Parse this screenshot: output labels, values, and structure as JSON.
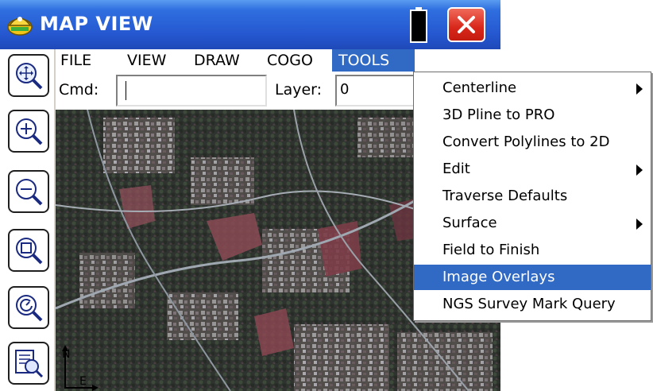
{
  "window": {
    "title": "MAP VIEW",
    "icons": {
      "app": "surveyor-hardhat-icon",
      "battery": "battery-icon",
      "close": "close-icon"
    },
    "colors": {
      "titlebar": "#2557d0",
      "close": "#d8271a",
      "highlight": "#316ac5"
    }
  },
  "menubar": {
    "items": [
      "FILE",
      "VIEW",
      "DRAW",
      "COGO",
      "TOOLS"
    ],
    "active": "TOOLS"
  },
  "cmdrow": {
    "cmd_label": "Cmd:",
    "cmd_value": "",
    "layer_label": "Layer:",
    "layer_value": "0"
  },
  "toolbar": {
    "buttons": [
      {
        "name": "zoom-extents",
        "icon": "magnifier-arrows-icon"
      },
      {
        "name": "zoom-in",
        "icon": "magnifier-plus-icon"
      },
      {
        "name": "zoom-out",
        "icon": "magnifier-minus-icon"
      },
      {
        "name": "zoom-window",
        "icon": "magnifier-window-icon"
      },
      {
        "name": "zoom-previous",
        "icon": "magnifier-previous-icon"
      },
      {
        "name": "view-options",
        "icon": "document-magnifier-icon"
      }
    ]
  },
  "map": {
    "north_label": "N",
    "east_label": "E",
    "description_icon": "aerial-image-overlay"
  },
  "tools_menu": {
    "items": [
      {
        "label": "Centerline",
        "submenu": true
      },
      {
        "label": "3D Pline to PRO",
        "submenu": false
      },
      {
        "label": "Convert Polylines to 2D",
        "submenu": false
      },
      {
        "label": "Edit",
        "submenu": true
      },
      {
        "label": "Traverse Defaults",
        "submenu": false
      },
      {
        "label": "Surface",
        "submenu": true
      },
      {
        "label": "Field to Finish",
        "submenu": false
      },
      {
        "label": "Image Overlays",
        "submenu": false,
        "highlighted": true
      },
      {
        "label": "NGS Survey Mark Query",
        "submenu": false
      }
    ]
  }
}
